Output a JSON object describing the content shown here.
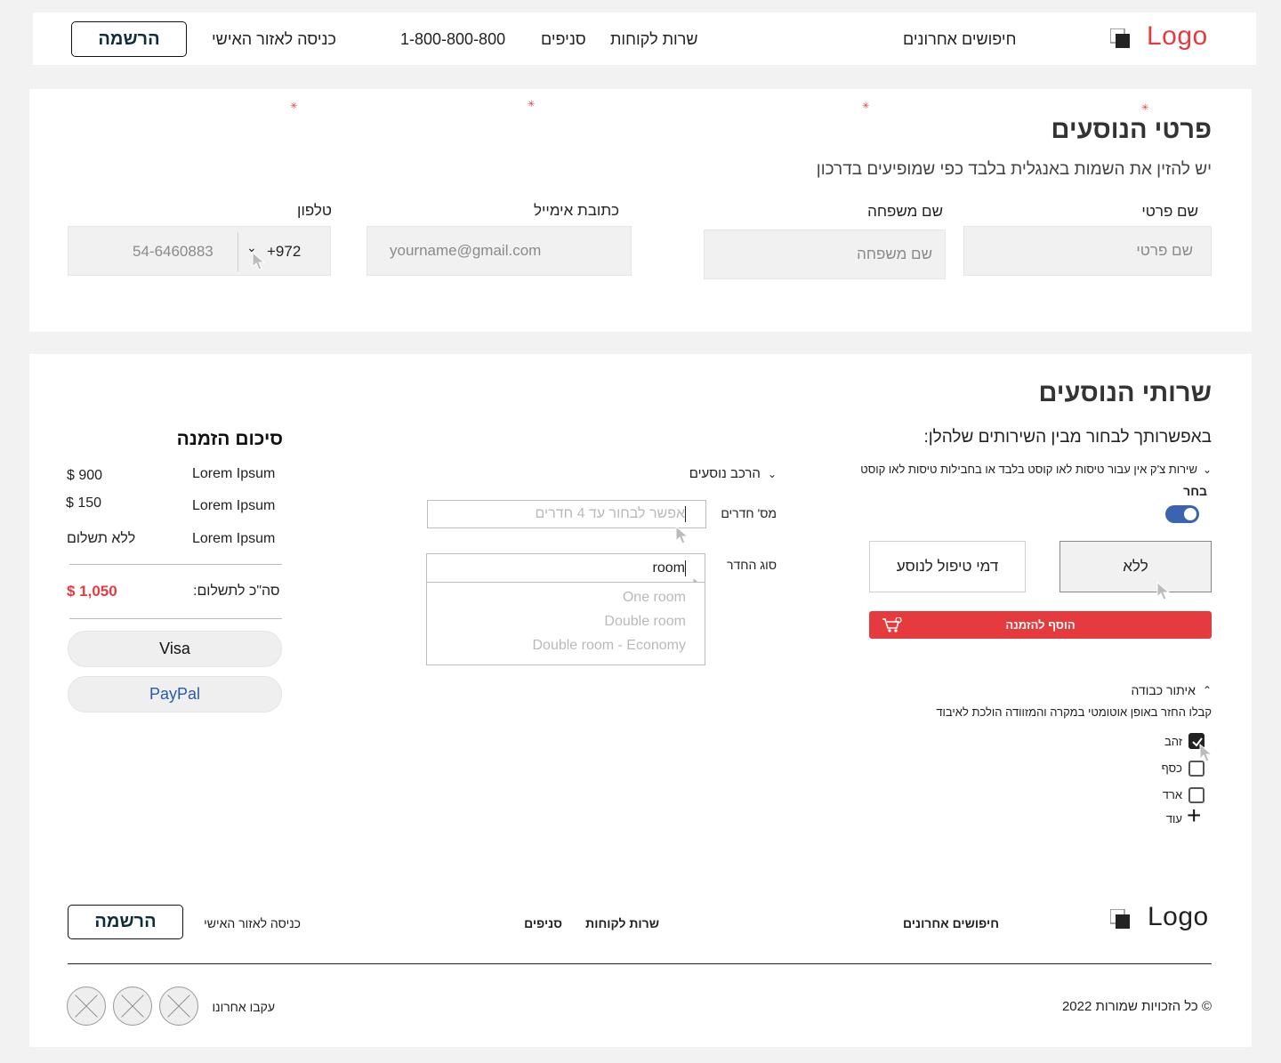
{
  "header": {
    "logo": "Logo",
    "recent_searches": "חיפושים אחרונים",
    "customer_service": "שרות לקוחות",
    "branches": "סניפים",
    "phone": "1-800-800-800",
    "personal_area": "כניסה לאזור האישי",
    "register": "הרשמה"
  },
  "passengers": {
    "title": "פרטי הנוסעים",
    "subtitle": "יש להזין את השמות באנגלית בלבד כפי שמופיעים בדרכון",
    "first_name_label": "שם פרטי",
    "first_name_placeholder": "שם פרטי",
    "last_name_label": "שם משפחה",
    "last_name_placeholder": "שם משפחה",
    "email_label": "כתובת אימייל",
    "email_placeholder": "yourname@gmail.com",
    "phone_label": "טלפון",
    "phone_prefix": "+972",
    "phone_value": "54-6460883"
  },
  "services": {
    "title": "שרותי הנוסעים",
    "subtitle": "באפשרותך לבחור מבין השירותים שלהלן:",
    "checkin_text": "שירות צ'ק אין עבור טיסות לאו קוסט בלבד או בחבילות טיסות לאו קוסט",
    "choose_label": "בחר",
    "option_none": "ללא",
    "option_fee": "דמי טיפול לנוסע",
    "add_to_order": "הוסף להזמנה",
    "luggage_title": "איתור כבודה",
    "luggage_desc": "קבלו החזר באופן אוטומטי במקרה והמזוודה הולכת לאיבוד",
    "luggage_options": [
      "זהב",
      "כסף",
      "ארד"
    ],
    "more": "עוד",
    "composition_title": "הרכב נוסעים",
    "rooms_label": "מס' חדרים",
    "rooms_placeholder": "אפשר לבחור עד 4 חדרים",
    "room_type_label": "סוג החדר",
    "room_type_value": "room",
    "room_type_options": [
      "One room",
      "Double room",
      "Double room - Economy"
    ]
  },
  "summary": {
    "title": "סיכום הזמנה",
    "items": [
      {
        "name": "Lorem Ipsum",
        "price": "$ 900"
      },
      {
        "name": "Lorem Ipsum",
        "price": "$ 150"
      },
      {
        "name": "Lorem Ipsum",
        "price": "ללא תשלום"
      }
    ],
    "total_label": "סה\"כ לתשלום:",
    "total_value": "$ 1,050",
    "visa": "Visa",
    "paypal": "PayPal"
  },
  "footer": {
    "logo": "Logo",
    "recent_searches": "חיפושים אחרונים",
    "customer_service": "שרות לקוחות",
    "branches": "סניפים",
    "personal_area": "כניסה לאזור האישי",
    "register": "הרשמה",
    "copyright": "© כל הזכויות שמורות  2022",
    "follow_us": "עקבו אחרונו"
  },
  "colors": {
    "accent_red": "#e53b3e",
    "toggle_blue": "#3b63b0",
    "paypal_blue": "#2a5aa8"
  }
}
